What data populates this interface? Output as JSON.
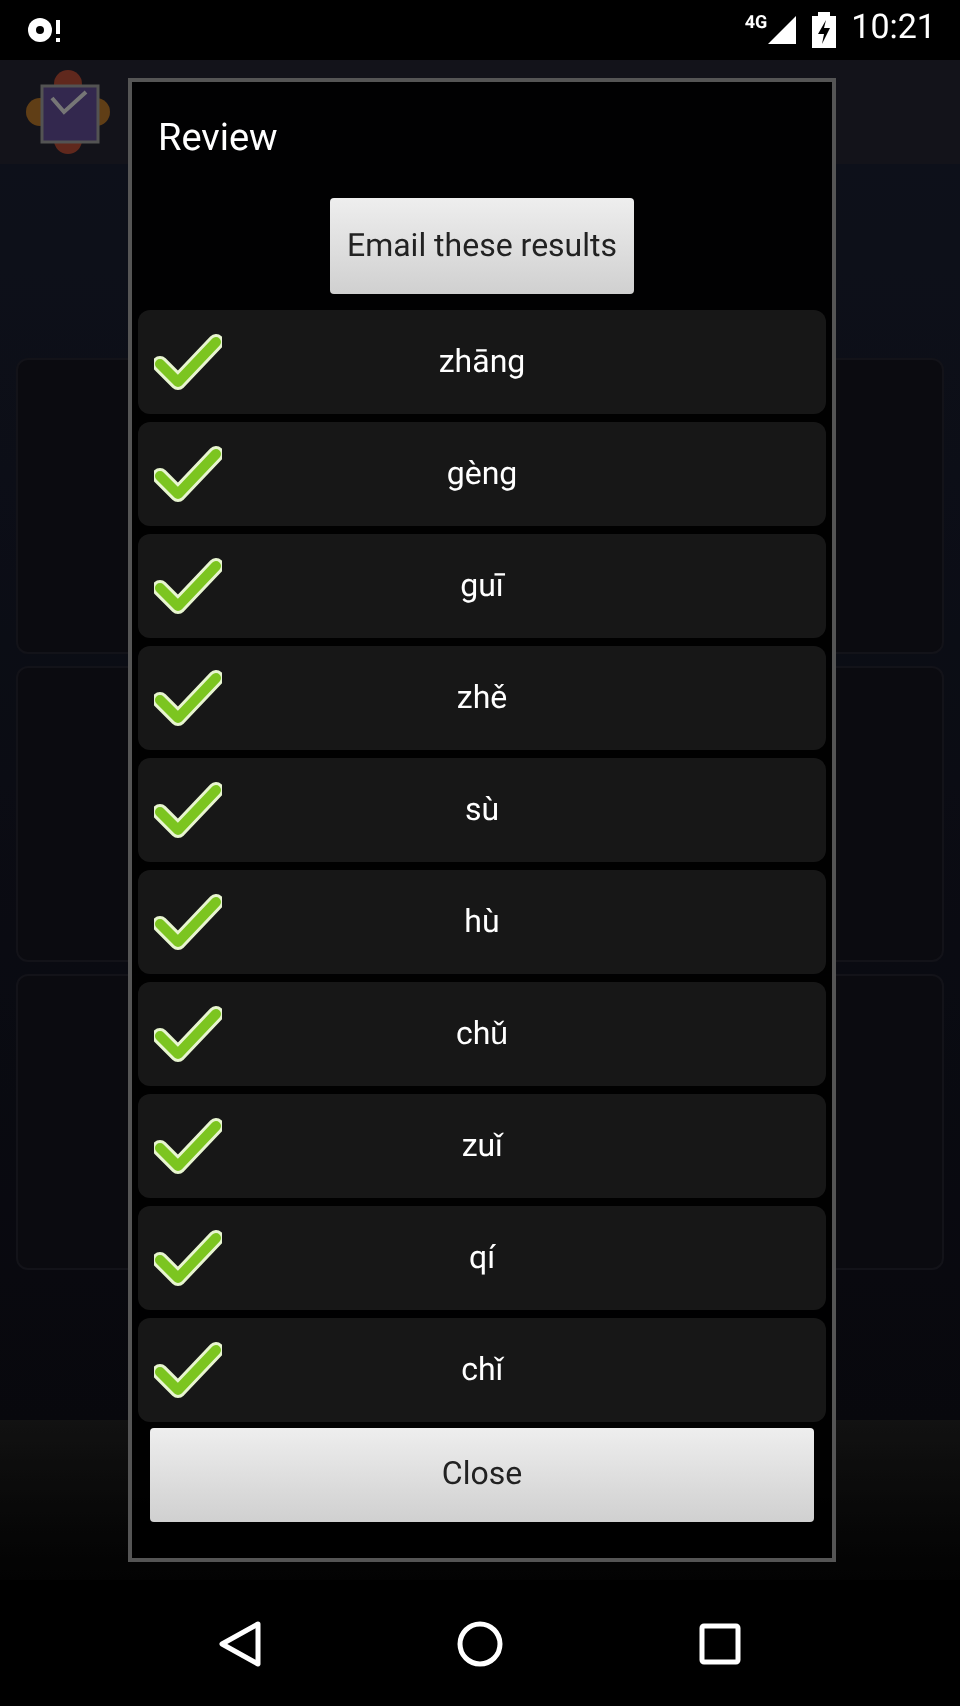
{
  "status_bar": {
    "time": "10:21",
    "network": "4G"
  },
  "dialog": {
    "title": "Review",
    "email_button": "Email these results",
    "close_button": "Close",
    "results": [
      {
        "pinyin": "zhāng",
        "correct": true
      },
      {
        "pinyin": "gèng",
        "correct": true
      },
      {
        "pinyin": "guī",
        "correct": true
      },
      {
        "pinyin": "zhě",
        "correct": true
      },
      {
        "pinyin": "sù",
        "correct": true
      },
      {
        "pinyin": "hù",
        "correct": true
      },
      {
        "pinyin": "chǔ",
        "correct": true
      },
      {
        "pinyin": "zuǐ",
        "correct": true
      },
      {
        "pinyin": "qí",
        "correct": true
      },
      {
        "pinyin": "chǐ",
        "correct": true
      }
    ]
  }
}
